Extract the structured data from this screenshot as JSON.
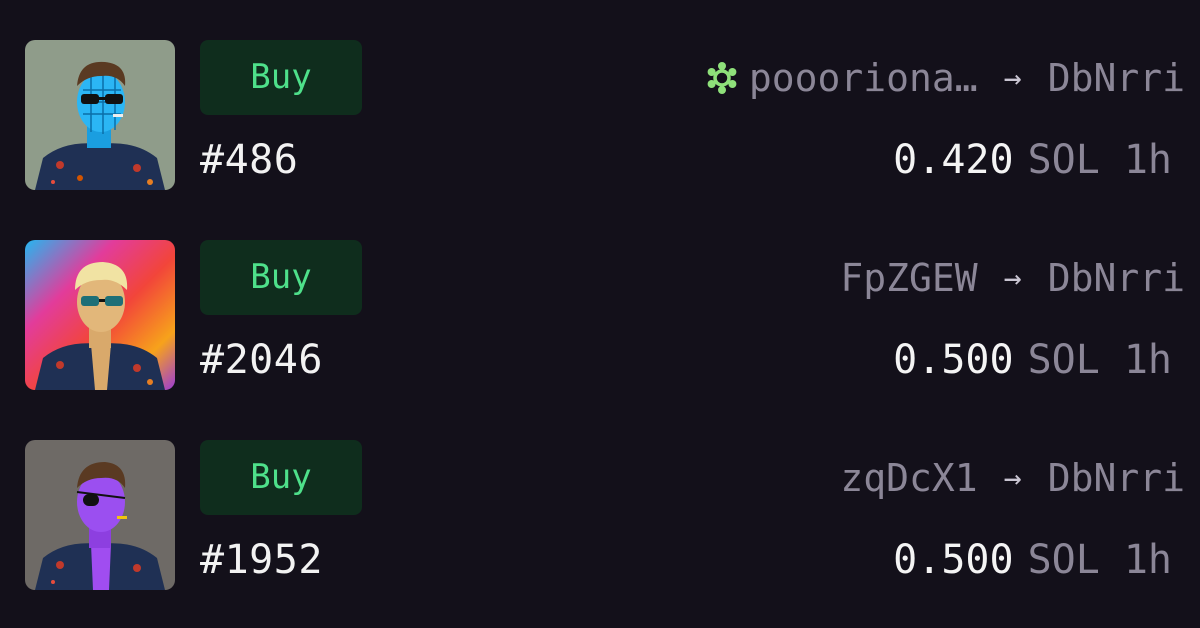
{
  "activity": [
    {
      "action_label": "Buy",
      "token_id": "#486",
      "from": "poooriona…",
      "from_badge_icon": "gear-badge-icon",
      "from_badge_color": "#8ee07a",
      "arrow": "→",
      "to": "DbNrri",
      "amount": "0.420",
      "currency": "SOL",
      "age": "1h"
    },
    {
      "action_label": "Buy",
      "token_id": "#2046",
      "from": "FpZGEW",
      "arrow": "→",
      "to": "DbNrri",
      "amount": "0.500",
      "currency": "SOL",
      "age": "1h"
    },
    {
      "action_label": "Buy",
      "token_id": "#1952",
      "from": "zqDcX1",
      "arrow": "→",
      "to": "DbNrri",
      "amount": "0.500",
      "currency": "SOL",
      "age": "1h"
    }
  ],
  "theme": {
    "background": "#13101a",
    "buy_button_bg": "#0f2d1d",
    "buy_button_text": "#4ee08a",
    "muted_text": "#8b8697",
    "primary_text": "#f4f4f4"
  }
}
